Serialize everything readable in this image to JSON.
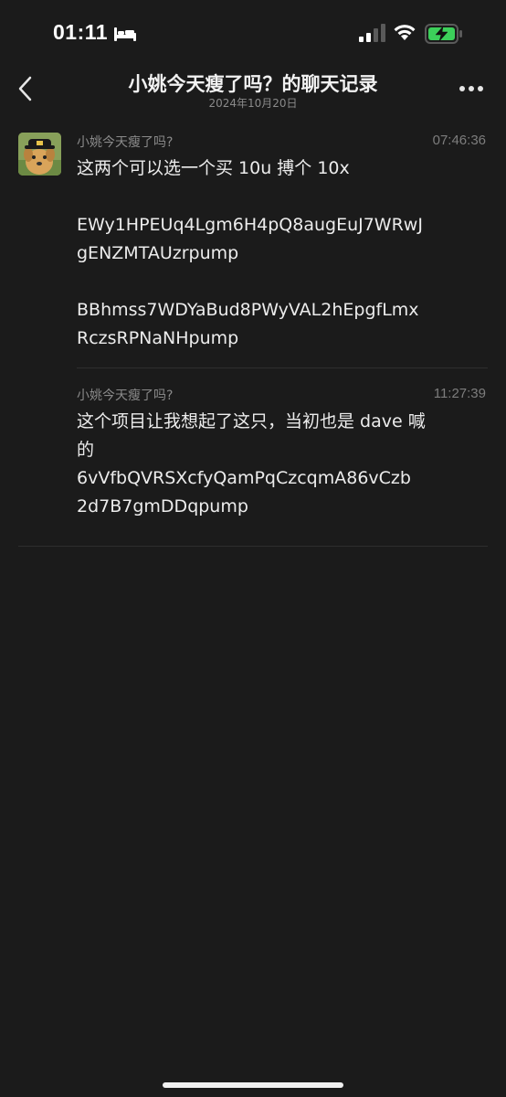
{
  "status_bar": {
    "time": "01:11",
    "icons": [
      "bed-icon",
      "signal-icon",
      "wifi-icon",
      "battery-charging-icon"
    ]
  },
  "nav": {
    "back_icon": "chevron-left-icon",
    "title": "小姚今天瘦了吗？的聊天记录",
    "subtitle": "2024年10月20日",
    "more_icon": "more-dots-icon"
  },
  "messages": [
    {
      "sender": "小姚今天瘦了吗?",
      "time": "07:46:36",
      "lines": [
        "这两个可以选一个买 10u 搏个 10x",
        "",
        "EWy1HPEUq4Lgm6H4pQ8augEuJ7WRwJ",
        "gENZMTAUzrpump",
        "",
        "BBhmss7WDYaBud8PWyVAL2hEpgfLmx",
        "RczsRPNaNHpump"
      ]
    },
    {
      "sender": "小姚今天瘦了吗?",
      "time": "11:27:39",
      "lines": [
        "这个项目让我想起了这只，当初也是 dave 喊",
        "的",
        "6vVfbQVRSXcfyQamPqCzcqmA86vCzb",
        "2d7B7gmDDqpump"
      ]
    }
  ],
  "colors": {
    "background": "#1b1b1b",
    "text": "#ececec",
    "muted": "#8a8a8a"
  }
}
